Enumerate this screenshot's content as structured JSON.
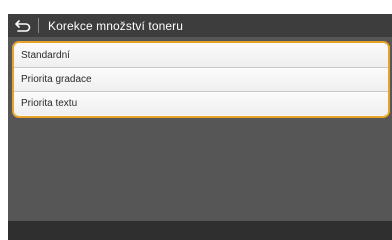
{
  "header": {
    "title": "Korekce množství toneru",
    "back_icon": "back-arrow-icon"
  },
  "options": [
    {
      "label": "Standardní"
    },
    {
      "label": "Priorita gradace"
    },
    {
      "label": "Priorita textu"
    }
  ],
  "colors": {
    "selection_border": "#e7a42a",
    "title_bar": "#3d3d3d",
    "screen_bg": "#565656",
    "bottom_bar": "#2f2f2f"
  }
}
